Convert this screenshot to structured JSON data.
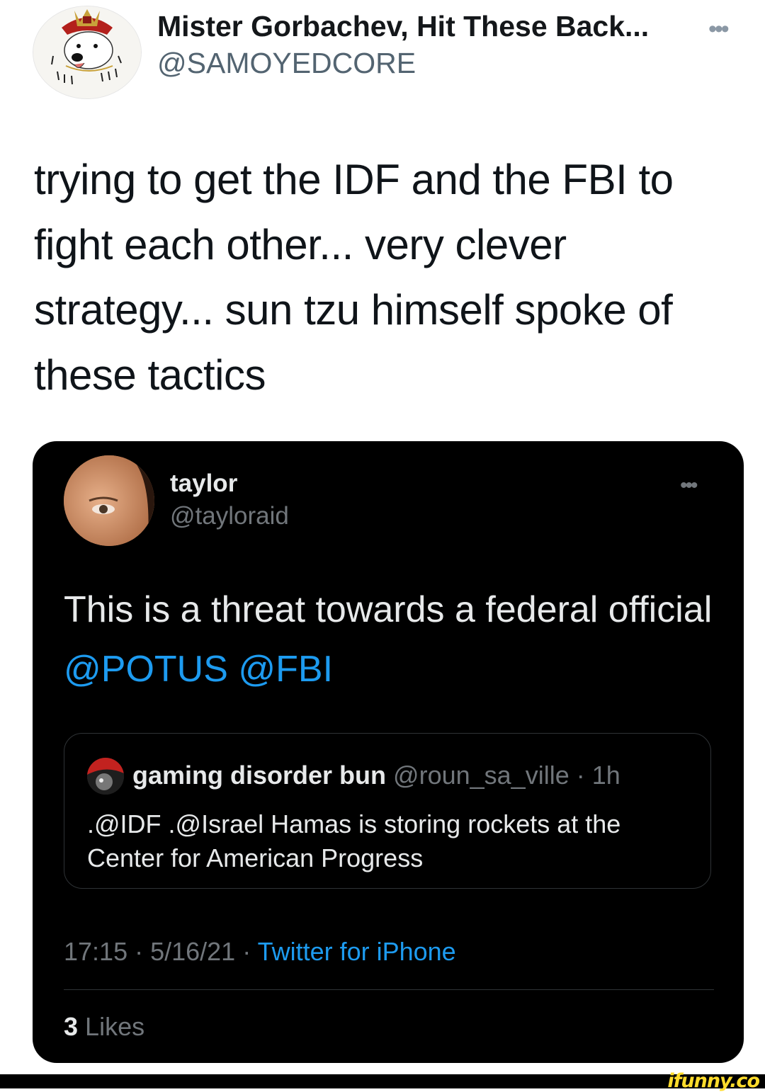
{
  "outer_tweet": {
    "display_name": "Mister Gorbachev, Hit These Back...",
    "handle": "@SAMOYEDCORE",
    "text": "trying to get the IDF and the FBI to fight each other... very clever strategy... sun tzu himself spoke of these tactics",
    "more_icon": "more-dots-icon"
  },
  "embedded_tweet": {
    "display_name": "taylor",
    "handle": "@tayloraid",
    "text_plain": "This is a threat towards a federal official ",
    "mentions": [
      "@POTUS",
      "@FBI"
    ],
    "quoted": {
      "display_name": "gaming disorder bun",
      "handle": "@roun_sa_ville",
      "time": "· 1h",
      "text": ".@IDF .@Israel Hamas is storing rockets at the Center for American Progress"
    },
    "time": "17:15",
    "date": "5/16/21",
    "source": "Twitter for iPhone",
    "likes_count": "3",
    "likes_label": "Likes"
  },
  "watermark": "ifunny.co",
  "colors": {
    "link_blue": "#1d9bf0",
    "card_bg": "#000000",
    "muted_dark": "#71767b",
    "muted_light": "#536471",
    "watermark_yellow": "#ffdc2c"
  }
}
